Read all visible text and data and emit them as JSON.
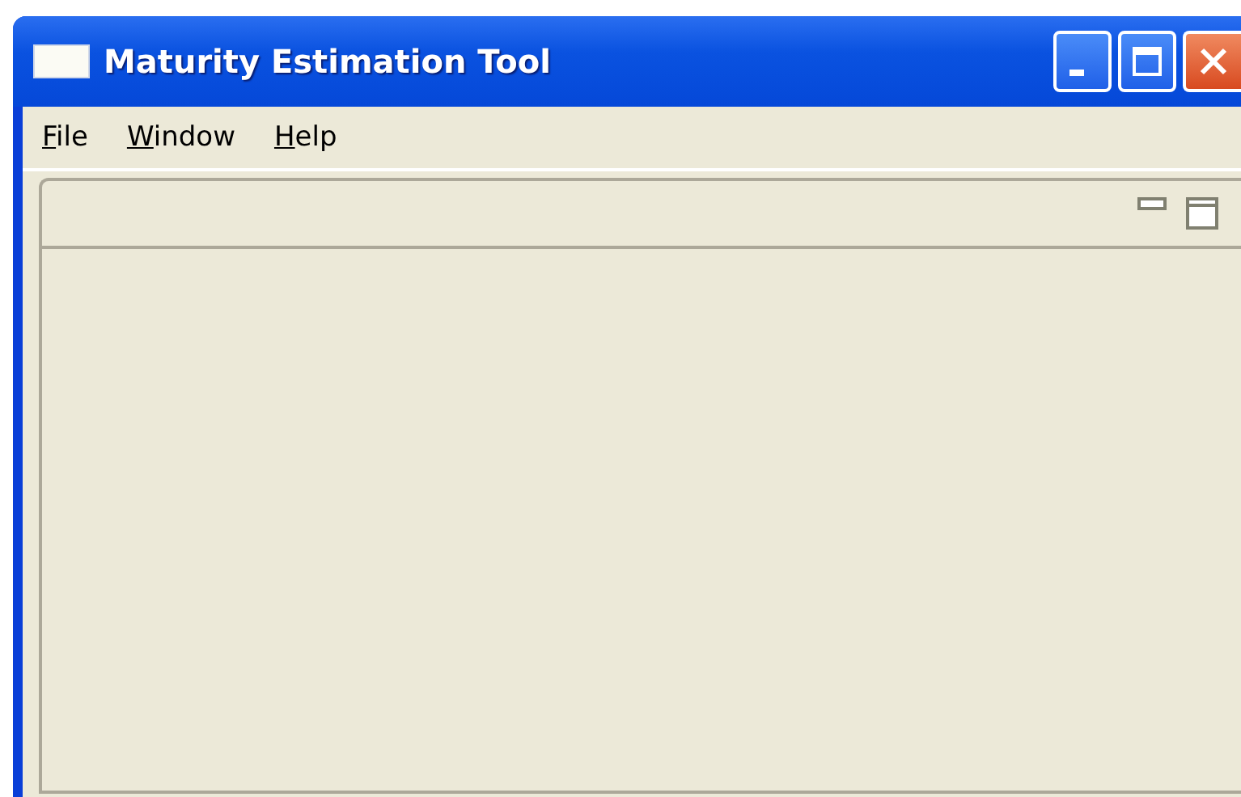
{
  "window": {
    "title": "Maturity Estimation Tool"
  },
  "menu": [
    {
      "label": "File"
    },
    {
      "label": "Window"
    },
    {
      "label": "Help"
    }
  ],
  "panel": {
    "controls": [
      {
        "kind": "minimize"
      },
      {
        "kind": "maximize"
      }
    ]
  }
}
